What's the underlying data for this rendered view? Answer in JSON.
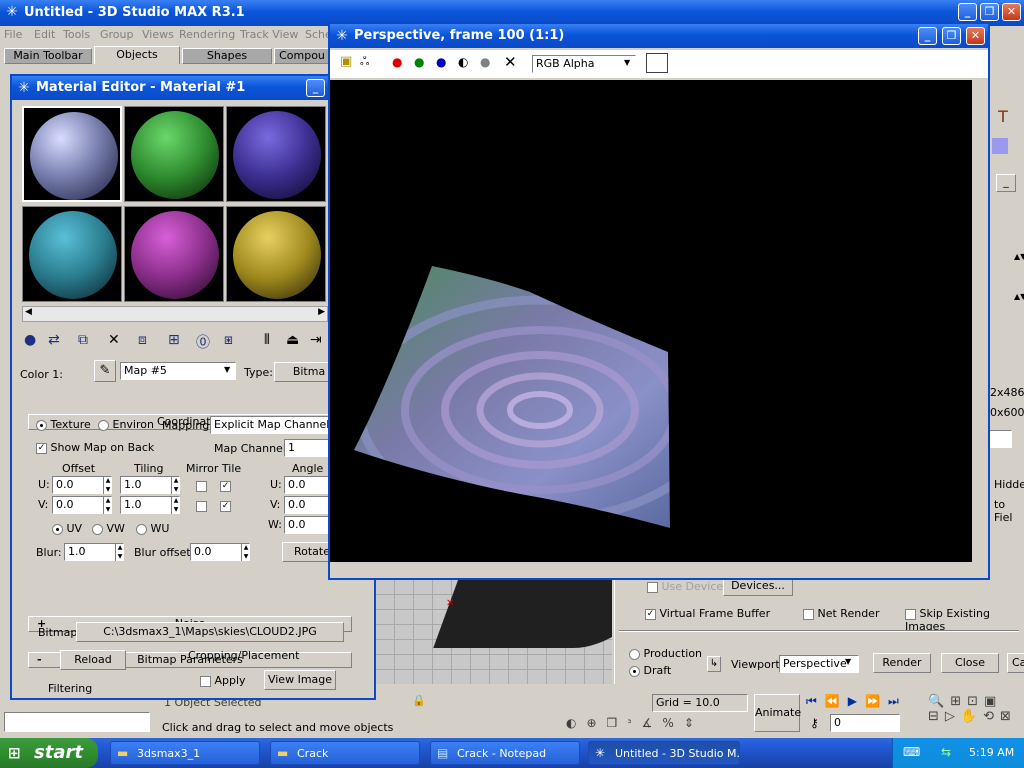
{
  "main_window": {
    "title": "Untitled - 3D Studio MAX R3.1",
    "menu": [
      "File",
      "Edit",
      "Tools",
      "Group",
      "Views",
      "Rendering",
      "Track View",
      "Sche"
    ],
    "tabs": [
      "Main Toolbar",
      "Objects",
      "Shapes",
      "Compou"
    ]
  },
  "material_editor": {
    "title": "Material Editor - Material #1",
    "spheres": [
      {
        "name": "sphere-1",
        "color": "#7a80b0"
      },
      {
        "name": "sphere-2",
        "color": "#2e8a2e"
      },
      {
        "name": "sphere-3",
        "color": "#3b2e8f"
      },
      {
        "name": "sphere-4",
        "color": "#2a7c8e"
      },
      {
        "name": "sphere-5",
        "color": "#8a2e8a"
      },
      {
        "name": "sphere-6",
        "color": "#a08a1e"
      }
    ],
    "color_label": "Color 1:",
    "map_name": "Map #5",
    "type_label": "Type:",
    "type_value": "Bitma",
    "coordinates": {
      "header": "Coordinates",
      "texture_label": "Texture",
      "environ_label": "Environ",
      "mapping_label": "Mapping:",
      "mapping_value": "Explicit Map Channel",
      "show_map_label": "Show Map on Back",
      "map_channel_label": "Map Channel:",
      "map_channel_value": "1",
      "offset_label": "Offset",
      "tiling_label": "Tiling",
      "mirror_tile_label": "Mirror Tile",
      "angle_label": "Angle",
      "u_label": "U:",
      "v_label": "V:",
      "w_label": "W:",
      "u_offset": "0.0",
      "v_offset": "0.0",
      "u_tiling": "1.0",
      "v_tiling": "1.0",
      "u_angle": "0.0",
      "v_angle": "0.0",
      "w_angle": "0.0",
      "uv_label": "UV",
      "vw_label": "VW",
      "wu_label": "WU",
      "blur_label": "Blur:",
      "blur_value": "1.0",
      "blur_offset_label": "Blur offset:",
      "blur_offset_value": "0.0",
      "rotate_label": "Rotate"
    },
    "noise_header": "Noise",
    "bitmap_params_header": "Bitmap Parameters",
    "bitmap_label": "Bitmap:",
    "bitmap_path": "C:\\3dsmax3_1\\Maps\\skies\\CLOUD2.JPG",
    "reload_label": "Reload",
    "cropping_label": "Cropping/Placement",
    "apply_label": "Apply",
    "view_image_label": "View Image",
    "filtering_label": "Filtering"
  },
  "perspective": {
    "title": "Perspective, frame 100 (1:1)",
    "channel_select": "RGB Alpha"
  },
  "render_panel": {
    "res1": "2x486",
    "res2": "0x600",
    "hidden_label": "Hidde",
    "to_field_label": "to Fiel",
    "use_device_label": "Use Device",
    "devices_label": "Devices...",
    "virtual_fb_label": "Virtual Frame Buffer",
    "net_render_label": "Net Render",
    "skip_existing_label": "Skip Existing Images",
    "production_label": "Production",
    "draft_label": "Draft",
    "viewport_label": "Viewport:",
    "viewport_value": "Perspective",
    "render_label": "Render",
    "close_label": "Close",
    "cancel_label": "Ca"
  },
  "status": {
    "selected": "1 Object Selected",
    "prompt": "Click and drag to select and move objects",
    "grid": "Grid = 10.0",
    "animate": "Animate",
    "frame": "0"
  },
  "taskbar": {
    "start": "start",
    "items": [
      "3dsmax3_1",
      "Crack",
      "Crack - Notepad",
      "Untitled - 3D Studio M..."
    ],
    "clock": "5:19 AM"
  }
}
